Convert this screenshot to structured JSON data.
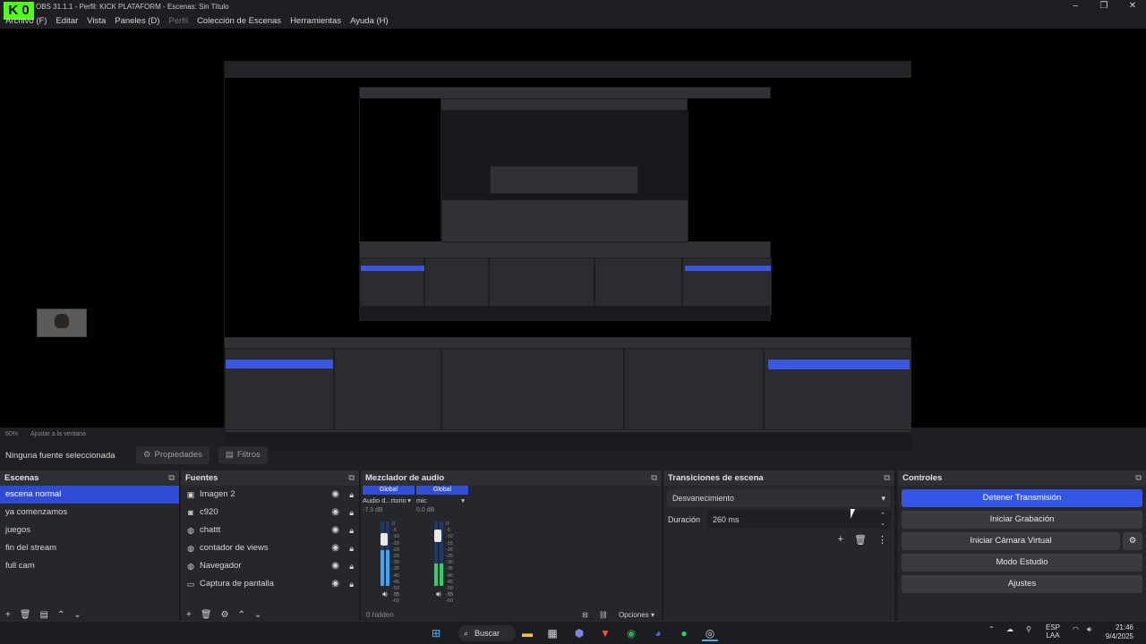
{
  "app": {
    "logo_text": "K  0",
    "title": "OBS 31.1.1 - Perfil: KICK PLATAFORM - Escenas: Sin Título"
  },
  "menu": [
    "Archivo (F)",
    "Editar",
    "Vista",
    "Paneles (D)",
    "Perfil",
    "Colección de Escenas",
    "Herramientas",
    "Ayuda (H)"
  ],
  "status": {
    "zoom": "60%",
    "fit": "Ajustar a la ventana"
  },
  "source_bar": {
    "label": "Ninguna fuente seleccionada",
    "properties": "Propiedades",
    "filters": "Filtros"
  },
  "scenes": {
    "title": "Escenas",
    "items": [
      "escena normal",
      "ya comenzamos",
      "juegos",
      "fin del stream",
      "full cam"
    ],
    "selected": 0
  },
  "sources": {
    "title": "Fuentes",
    "items": [
      {
        "label": "Imagen 2",
        "icon": "image-icon"
      },
      {
        "label": "c920",
        "icon": "camera-icon"
      },
      {
        "label": "chattt",
        "icon": "browser-icon"
      },
      {
        "label": "contador de views",
        "icon": "browser-icon"
      },
      {
        "label": "Navegador",
        "icon": "browser-icon"
      },
      {
        "label": "Captura de pantalla",
        "icon": "monitor-icon"
      }
    ]
  },
  "mixer": {
    "title": "Mezclador de audio",
    "channels": [
      {
        "tag": "Global",
        "name": "Audio d...rtorio",
        "db": "-7.3 dB",
        "level": 0.55,
        "fader": 0.82
      },
      {
        "tag": "Global",
        "name": "mic",
        "db": "0.0 dB",
        "level": 0.35,
        "fader": 0.88
      }
    ],
    "scale": [
      "0",
      "-5",
      "-10",
      "-15",
      "-20",
      "-25",
      "-30",
      "-35",
      "-40",
      "-45",
      "-50",
      "-55",
      "-60"
    ],
    "hidden": "0 hidden",
    "options": "Opciones"
  },
  "transitions": {
    "title": "Transiciones de escena",
    "type": "Desvanecimiento",
    "duration_label": "Duración",
    "duration": "260 ms"
  },
  "controls": {
    "title": "Controles",
    "buttons": [
      "Detener Transmisión",
      "Iniciar Grabación",
      "Iniciar Cámara Virtual",
      "Modo Estudio",
      "Ajustes"
    ]
  },
  "taskbar": {
    "search": "Buscar",
    "lang1": "ESP",
    "lang2": "LAA",
    "time": "21:46",
    "date": "9/4/2025"
  }
}
